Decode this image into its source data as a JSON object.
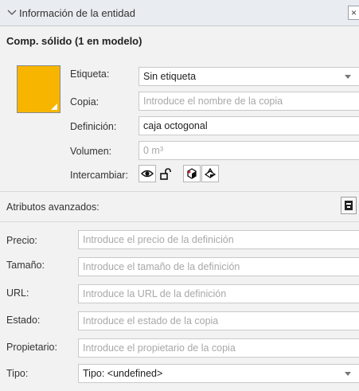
{
  "header": {
    "title": "Información de la entidad",
    "close_label": "×"
  },
  "entity": {
    "title": "Comp. sólido (1 en modelo)",
    "color": "#f7b500"
  },
  "labels": {
    "etiqueta": "Etiqueta:",
    "copia": "Copia:",
    "definicion": "Definición:",
    "volumen": "Volumen:",
    "intercambiar": "Intercambiar:",
    "atributos_avanzados": "Atributos avanzados:",
    "precio": "Precio:",
    "tamano": "Tamaño:",
    "url": "URL:",
    "estado": "Estado:",
    "propietario": "Propietario:",
    "tipo": "Tipo:"
  },
  "fields": {
    "etiqueta_value": "Sin etiqueta",
    "copia_placeholder": "Introduce el nombre de la copia",
    "definicion_value": "caja octogonal",
    "volumen_placeholder": "0 m³",
    "precio_placeholder": "Introduce el precio de la definición",
    "tamano_placeholder": "Introduce el tamaño de la definición",
    "url_placeholder": "Introduce la URL de la definición",
    "estado_placeholder": "Introduce el estado de la copia",
    "propietario_placeholder": "Introduce el propietario de la copia",
    "tipo_value": "Tipo: <undefined>"
  },
  "toggles": [
    "eye-icon",
    "unlock-icon",
    "cast-shadows-icon",
    "receive-shadows-icon"
  ]
}
